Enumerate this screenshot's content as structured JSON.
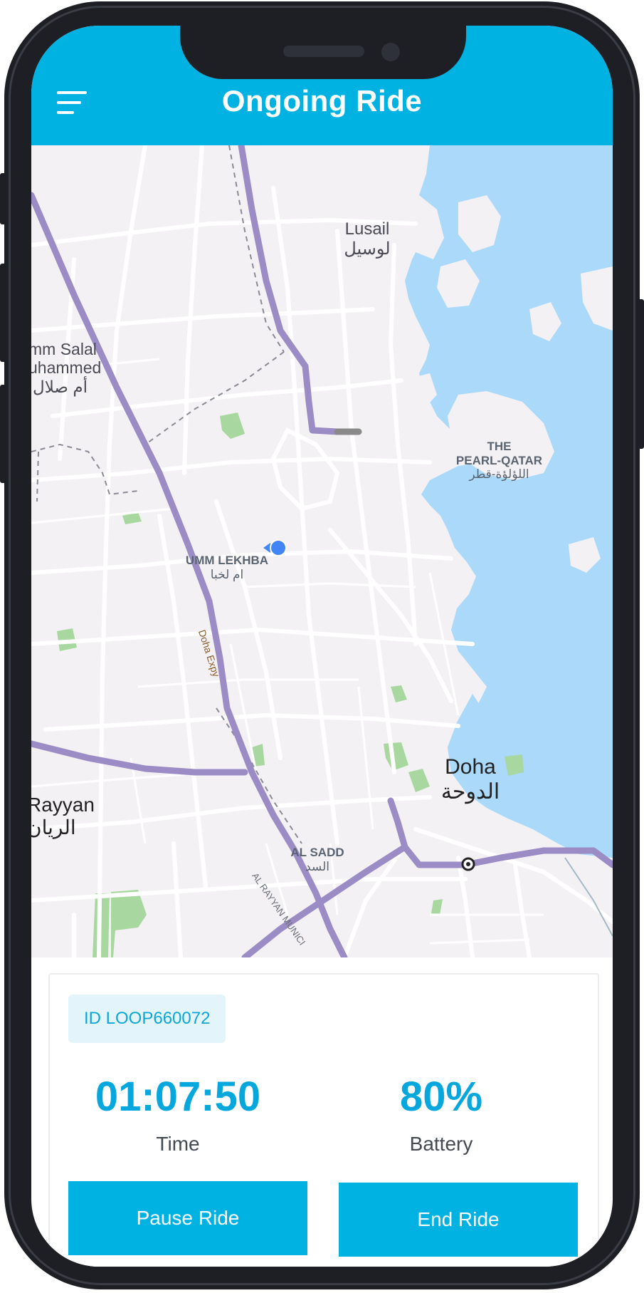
{
  "header": {
    "title": "Ongoing Ride",
    "menu_icon": "menu-icon",
    "background_color": "#00b2e2"
  },
  "map": {
    "labels": {
      "lusail_en": "Lusail",
      "lusail_ar": "لوسيل",
      "umm_salal_en1": "mm Salal",
      "umm_salal_en2": "uhammed",
      "umm_salal_ar": "أم صلال",
      "pearl_en1": "THE",
      "pearl_en2": "PEARL-QATAR",
      "pearl_ar": "اللؤلؤة-قطر",
      "umm_lekhba_en": "UMM LEKHBA",
      "umm_lekhba_ar": "ام لخبا",
      "doha_expy": "Doha Expy",
      "doha_en": "Doha",
      "doha_ar": "الدوحة",
      "rayyan_en": "Rayyan",
      "rayyan_ar": "الريان",
      "al_sadd_en": "AL SADD",
      "al_sadd_ar": "السد",
      "al_rayyan_road": "AL RAYYAN MUNICI"
    },
    "water_color": "#aad9fa",
    "route_color": "#9b8cc6",
    "park_color": "#a8d8a0",
    "location_marker": "current-location-icon"
  },
  "ride": {
    "id_label": "ID LOOP660072",
    "time_value": "01:07:50",
    "time_label": "Time",
    "battery_value": "80%",
    "battery_label": "Battery",
    "pause_label": "Pause Ride",
    "end_label": "End Ride",
    "accent_color": "#06a7dc"
  }
}
